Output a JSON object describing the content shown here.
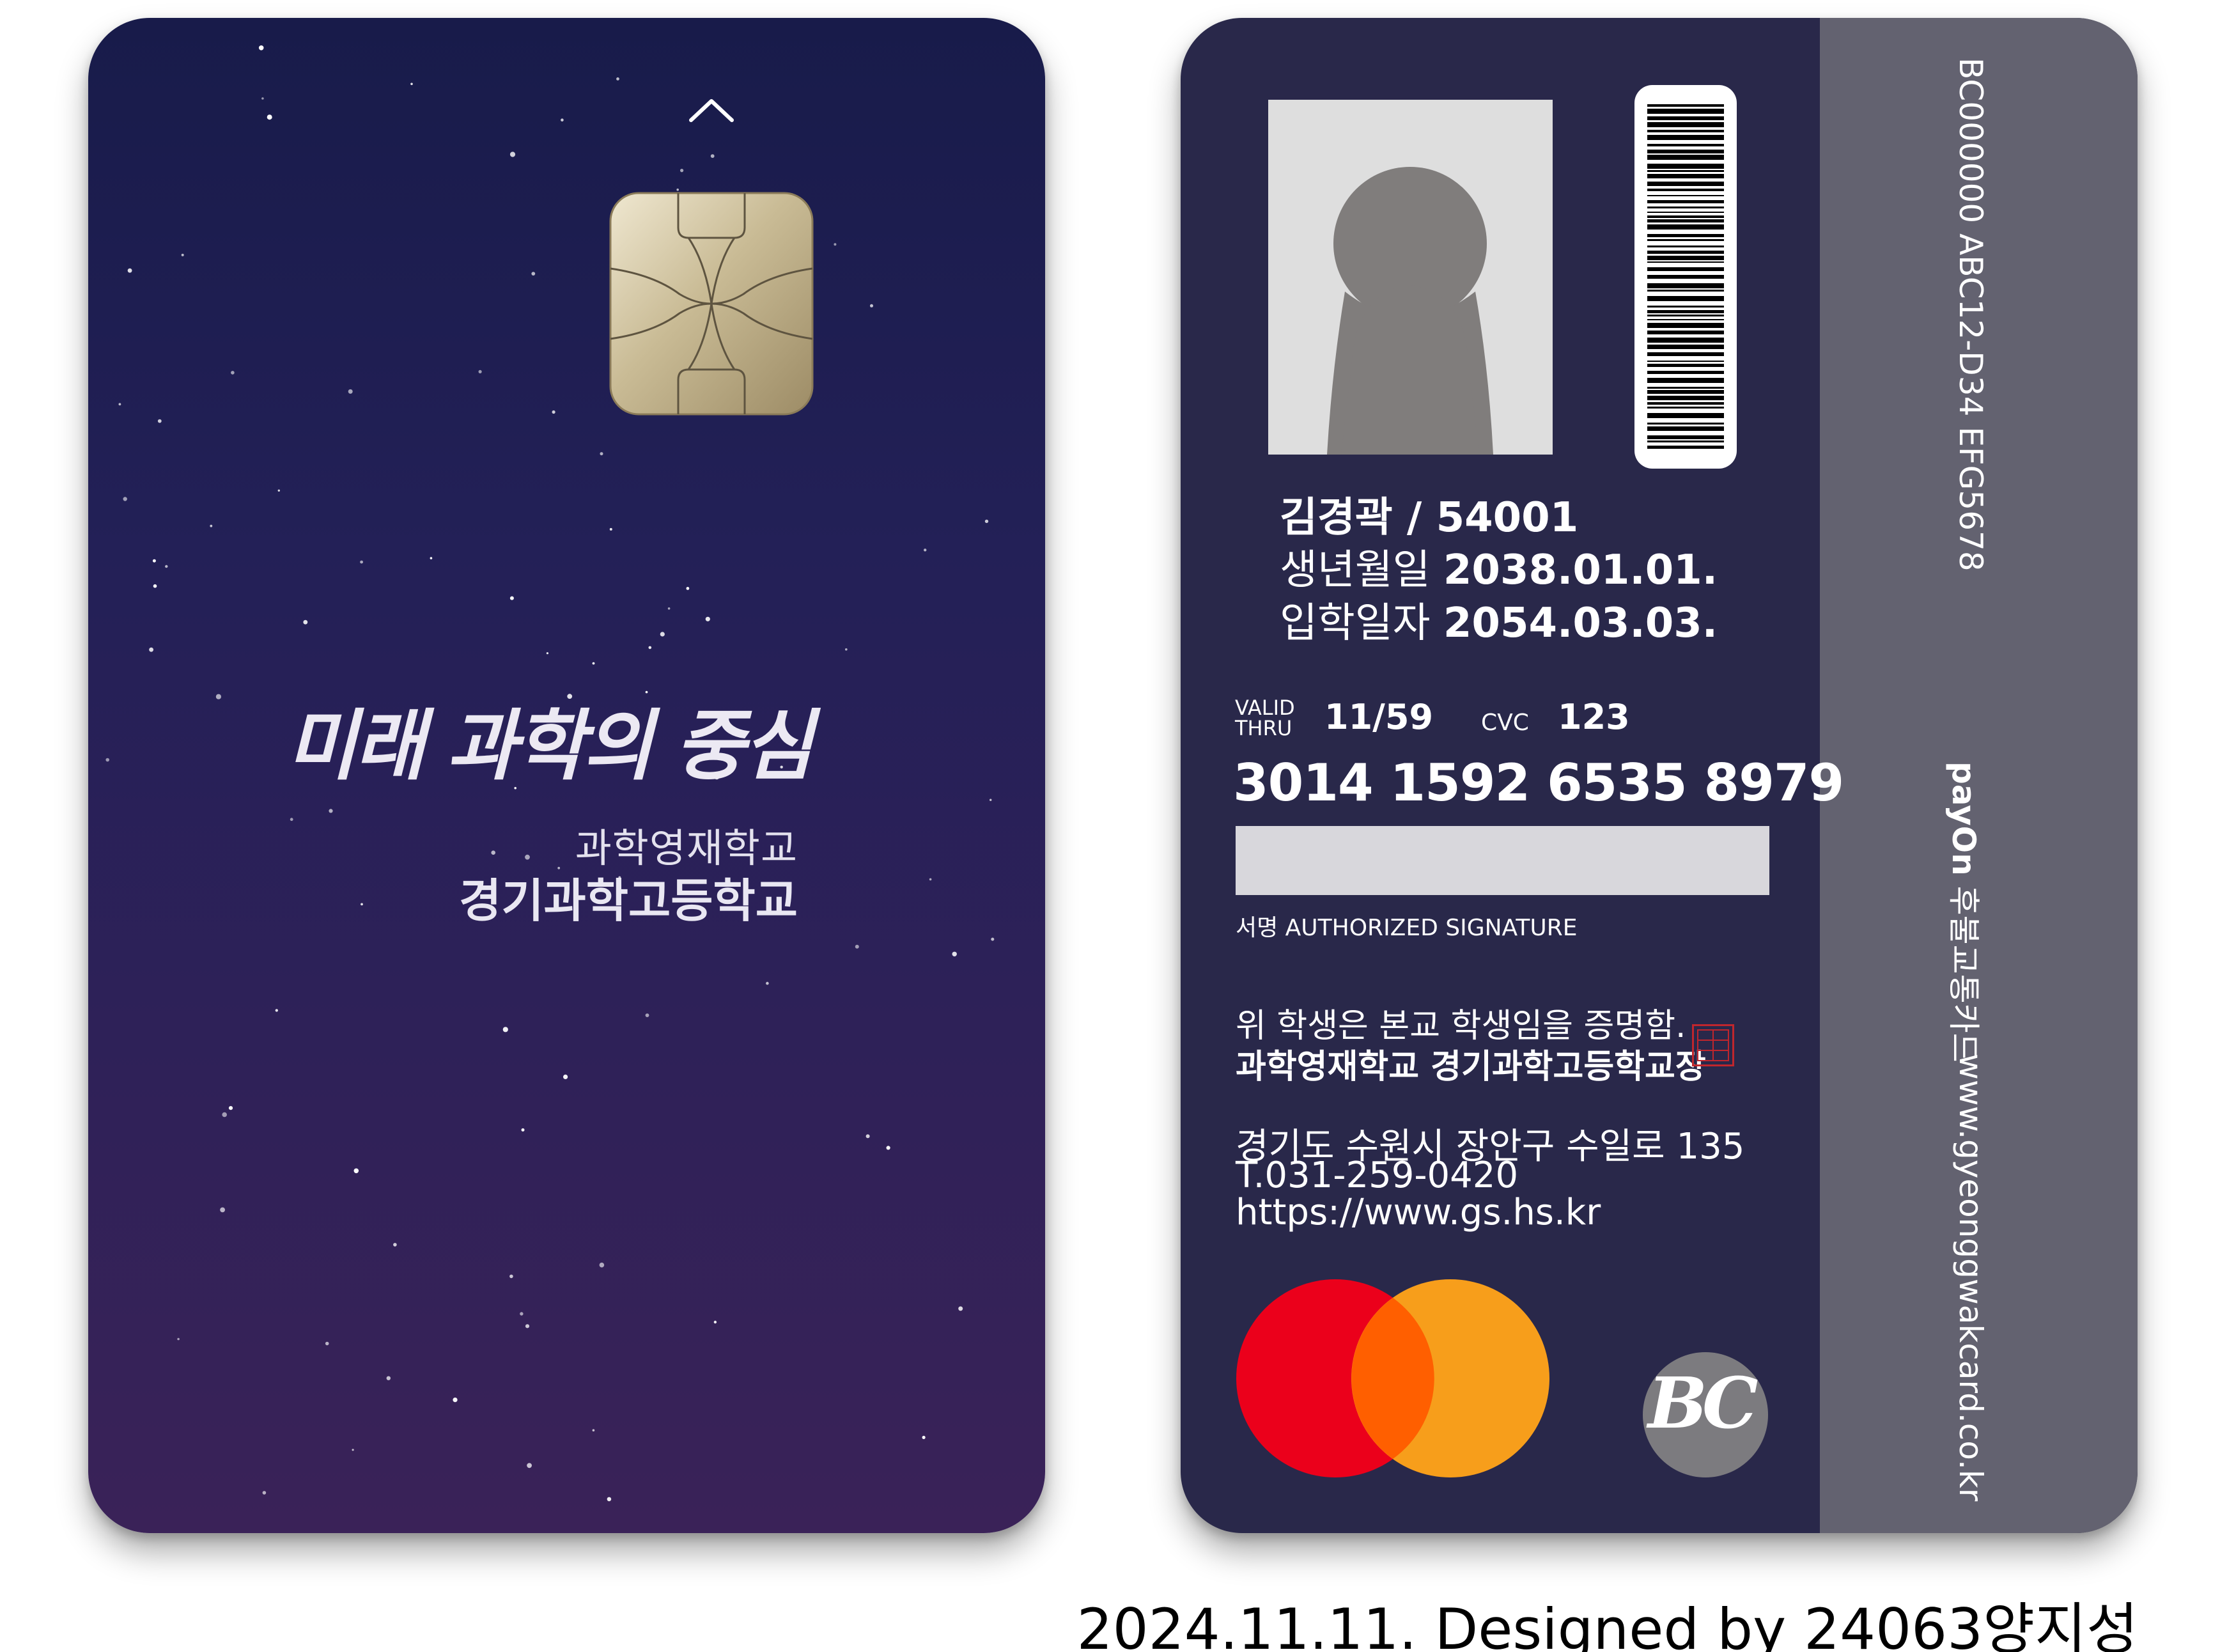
{
  "front": {
    "slogan": "미래 과학의 중심",
    "school_sub": "과학영재학교",
    "school_main": "경기과학고등학교",
    "icons": [
      "chevron-up-icon",
      "ic-chip-icon",
      "star-field"
    ]
  },
  "back": {
    "vertical_serial": "BC000000  ABC12-D34 EFG5678",
    "vertical_brand_bold": "payOn",
    "vertical_brand": " 후불교통카드",
    "vertical_url": "www.gyeonggwakcard.co.kr",
    "name_id": "김경곽 / 54001",
    "birth_label": "생년월일",
    "birth_value": "2038.01.01.",
    "admission_label": "입학일자",
    "admission_value": "2054.03.03.",
    "valid_label_1": "VALID",
    "valid_label_2": "THRU",
    "valid_value": "11/59",
    "cvc_label": "CVC",
    "cvc_value": "123",
    "card_number": "3014 1592 6535 8979",
    "signature_label": "서명 AUTHORIZED SIGNATURE",
    "certificate_line1": "위 학생은 본교 학생임을 증명함.",
    "certificate_line2": "과학영재학교 경기과학고등학교장",
    "address": "경기도 수원시 장안구 수일로 135",
    "phone": "T.031-259-0420",
    "website": "https://www.gs.hs.kr",
    "bc_logo_text": "BC",
    "icons": [
      "photo-placeholder-icon",
      "barcode",
      "seal-stamp",
      "mastercard-logo",
      "bc-card-logo"
    ]
  },
  "footer": {
    "credit": "2024.11.11. Designed by 24063양지성"
  },
  "colors": {
    "front_top": "#181b4a",
    "front_bottom": "#3a2258",
    "back_bg": "#29284a",
    "back_stripe": "#636270",
    "mastercard_red": "#eb001b",
    "mastercard_orange": "#f79e1b",
    "mastercard_overlap": "#ff5f00",
    "seal_red": "#c0262d"
  }
}
